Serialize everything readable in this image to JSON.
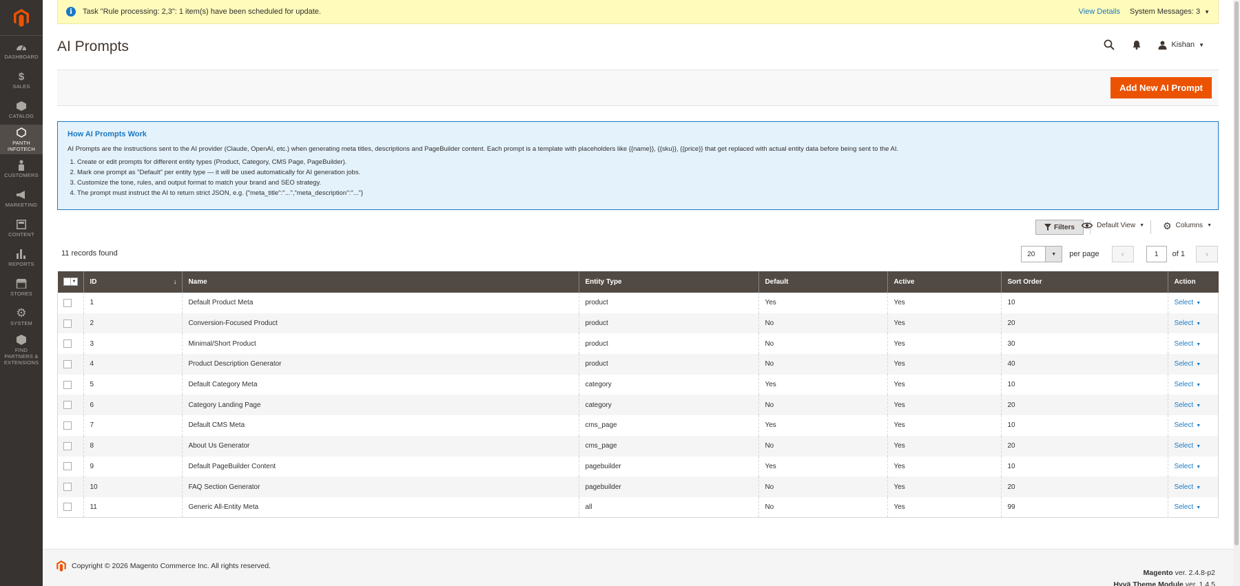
{
  "sidebar": {
    "items": [
      {
        "label": "DASHBOARD",
        "icon": "dashboard-icon"
      },
      {
        "label": "$",
        "label2": "SALES",
        "icon": "dollar-icon"
      },
      {
        "label": "CATALOG",
        "icon": "catalog-icon"
      },
      {
        "label": "PANTH INFOTECH",
        "icon": "hexagon-icon"
      },
      {
        "label": "CUSTOMERS",
        "icon": "customers-icon"
      },
      {
        "label": "MARKETING",
        "icon": "megaphone-icon"
      },
      {
        "label": "CONTENT",
        "icon": "content-icon"
      },
      {
        "label": "REPORTS",
        "icon": "reports-icon"
      },
      {
        "label": "STORES",
        "icon": "stores-icon"
      },
      {
        "label": "SYSTEM",
        "icon": "gear-icon"
      },
      {
        "label": "FIND PARTNERS & EXTENSIONS",
        "icon": "partners-icon"
      }
    ]
  },
  "notice": {
    "message": "Task \"Rule processing: 2,3\": 1 item(s) have been scheduled for update.",
    "view_details": "View Details",
    "system_messages": "System Messages: 3"
  },
  "header": {
    "title": "AI Prompts",
    "user": "Kishan"
  },
  "actions": {
    "add_new": "Add New AI Prompt"
  },
  "info": {
    "title": "How AI Prompts Work",
    "description": "AI Prompts are the instructions sent to the AI provider (Claude, OpenAI, etc.) when generating meta titles, descriptions and PageBuilder content. Each prompt is a template with placeholders like {{name}}, {{sku}}, {{price}} that get replaced with actual entity data before being sent to the AI.",
    "steps": [
      "Create or edit prompts for different entity types (Product, Category, CMS Page, PageBuilder).",
      "Mark one prompt as \"Default\" per entity type — it will be used automatically for AI generation jobs.",
      "Customize the tone, rules, and output format to match your brand and SEO strategy.",
      "The prompt must instruct the AI to return strict JSON, e.g. {\"meta_title\":\"...\",\"meta_description\":\"...\"}"
    ]
  },
  "toolbar": {
    "filters": "Filters",
    "view": "Default View",
    "columns": "Columns",
    "records_found": "11 records found",
    "per_page_value": "20",
    "per_page_label": "per page",
    "current_page": "1",
    "of_pages": "of 1"
  },
  "grid": {
    "columns": [
      "ID",
      "Name",
      "Entity Type",
      "Default",
      "Active",
      "Sort Order",
      "Action"
    ],
    "action_label": "Select",
    "rows": [
      [
        "1",
        "Default Product Meta",
        "product",
        "Yes",
        "Yes",
        "10"
      ],
      [
        "2",
        "Conversion-Focused Product",
        "product",
        "No",
        "Yes",
        "20"
      ],
      [
        "3",
        "Minimal/Short Product",
        "product",
        "No",
        "Yes",
        "30"
      ],
      [
        "4",
        "Product Description Generator",
        "product",
        "No",
        "Yes",
        "40"
      ],
      [
        "5",
        "Default Category Meta",
        "category",
        "Yes",
        "Yes",
        "10"
      ],
      [
        "6",
        "Category Landing Page",
        "category",
        "No",
        "Yes",
        "20"
      ],
      [
        "7",
        "Default CMS Meta",
        "cms_page",
        "Yes",
        "Yes",
        "10"
      ],
      [
        "8",
        "About Us Generator",
        "cms_page",
        "No",
        "Yes",
        "20"
      ],
      [
        "9",
        "Default PageBuilder Content",
        "pagebuilder",
        "Yes",
        "Yes",
        "10"
      ],
      [
        "10",
        "FAQ Section Generator",
        "pagebuilder",
        "No",
        "Yes",
        "20"
      ],
      [
        "11",
        "Generic All-Entity Meta",
        "all",
        "No",
        "Yes",
        "99"
      ]
    ]
  },
  "footer": {
    "copyright": "Copyright © 2026 Magento Commerce Inc. All rights reserved.",
    "magento_name": "Magento",
    "magento_ver": " ver. 2.4.8-p2",
    "hyva_name": "Hyvä Theme Module",
    "hyva_ver": " ver. 1.4.5"
  },
  "colors": {
    "accent": "#eb5202",
    "link": "#1979c3",
    "sidebar": "#373330",
    "grid_header": "#514943"
  }
}
